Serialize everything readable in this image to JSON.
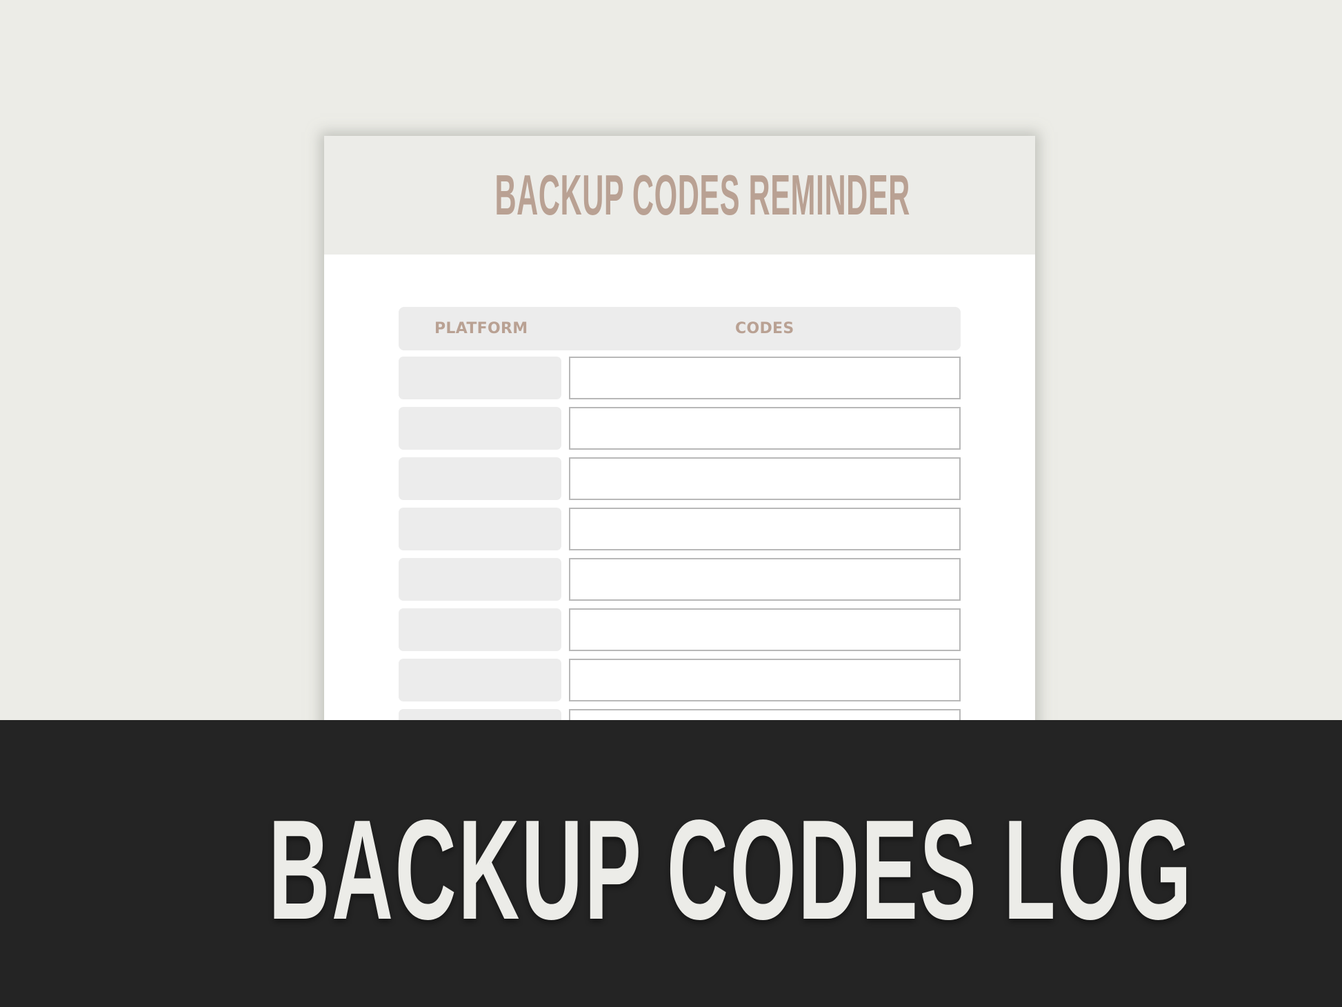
{
  "document": {
    "title": "BACKUP CODES REMINDER",
    "table": {
      "columns": [
        "PLATFORM",
        "CODES"
      ],
      "rows": [
        {
          "platform": "",
          "codes": ""
        },
        {
          "platform": "",
          "codes": ""
        },
        {
          "platform": "",
          "codes": ""
        },
        {
          "platform": "",
          "codes": ""
        },
        {
          "platform": "",
          "codes": ""
        },
        {
          "platform": "",
          "codes": ""
        },
        {
          "platform": "",
          "codes": ""
        },
        {
          "platform": "",
          "codes": ""
        }
      ]
    }
  },
  "banner": {
    "title": "BACKUP CODES LOG"
  },
  "colors": {
    "background": "#ecece7",
    "accent_text": "#b9a193",
    "banner_background": "#242424",
    "banner_text": "#ecece8",
    "cell_fill": "#ececec",
    "box_border": "#b8b8b8"
  }
}
